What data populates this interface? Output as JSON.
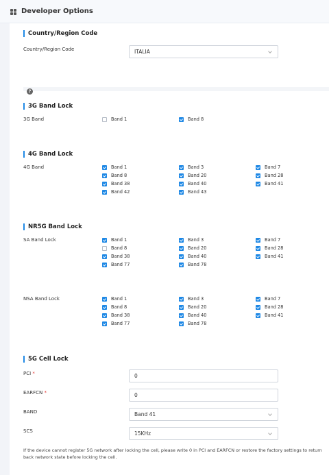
{
  "header": {
    "title": "Developer Options",
    "icon": "grid-icon"
  },
  "country": {
    "section_title": "Country/Region Code",
    "label": "Country/Region Code",
    "value": "ITALIA"
  },
  "help": {
    "glyph": "?"
  },
  "band3g": {
    "section_title": "3G Band Lock",
    "groups": [
      {
        "label": "3G Band",
        "bands": [
          {
            "name": "Band 1",
            "checked": false
          },
          {
            "name": "Band 8",
            "checked": true
          }
        ]
      }
    ]
  },
  "band4g": {
    "section_title": "4G Band Lock",
    "groups": [
      {
        "label": "4G Band",
        "bands": [
          {
            "name": "Band 1",
            "checked": true
          },
          {
            "name": "Band 3",
            "checked": true
          },
          {
            "name": "Band 7",
            "checked": true
          },
          {
            "name": "Band 8",
            "checked": true
          },
          {
            "name": "Band 20",
            "checked": true
          },
          {
            "name": "Band 28",
            "checked": true
          },
          {
            "name": "Band 38",
            "checked": true
          },
          {
            "name": "Band 40",
            "checked": true
          },
          {
            "name": "Band 41",
            "checked": true
          },
          {
            "name": "Band 42",
            "checked": true
          },
          {
            "name": "Band 43",
            "checked": true
          }
        ]
      }
    ]
  },
  "nr5g": {
    "section_title": "NR5G Band Lock",
    "groups": [
      {
        "label": "SA Band Lock",
        "bands": [
          {
            "name": "Band 1",
            "checked": true
          },
          {
            "name": "Band 3",
            "checked": true
          },
          {
            "name": "Band 7",
            "checked": true
          },
          {
            "name": "Band 8",
            "checked": false
          },
          {
            "name": "Band 20",
            "checked": true
          },
          {
            "name": "Band 28",
            "checked": true
          },
          {
            "name": "Band 38",
            "checked": true
          },
          {
            "name": "Band 40",
            "checked": true
          },
          {
            "name": "Band 41",
            "checked": true
          },
          {
            "name": "Band 77",
            "checked": true
          },
          {
            "name": "Band 78",
            "checked": true
          }
        ]
      },
      {
        "label": "NSA Band Lock",
        "bands": [
          {
            "name": "Band 1",
            "checked": true
          },
          {
            "name": "Band 3",
            "checked": true
          },
          {
            "name": "Band 7",
            "checked": true
          },
          {
            "name": "Band 8",
            "checked": true
          },
          {
            "name": "Band 20",
            "checked": true
          },
          {
            "name": "Band 28",
            "checked": true
          },
          {
            "name": "Band 38",
            "checked": true
          },
          {
            "name": "Band 40",
            "checked": true
          },
          {
            "name": "Band 41",
            "checked": true
          },
          {
            "name": "Band 77",
            "checked": true
          },
          {
            "name": "Band 78",
            "checked": true
          }
        ]
      }
    ]
  },
  "cell_lock": {
    "section_title": "5G Cell Lock",
    "pci": {
      "label": "PCI",
      "required_mark": "*",
      "value": "0"
    },
    "earfcn": {
      "label": "EARFCN",
      "required_mark": "*",
      "value": "0"
    },
    "band": {
      "label": "BAND",
      "value": "Band 41"
    },
    "scs": {
      "label": "SCS",
      "value": "15KHz"
    },
    "note": "If the device cannot register 5G network after locking the cell, please write 0 in PCI and EARFCN or restore the factory settings to return back network state before locking the cell."
  },
  "colors": {
    "accent": "#1e88e5",
    "required": "#e53935",
    "page_bg": "#f2f4f8"
  }
}
